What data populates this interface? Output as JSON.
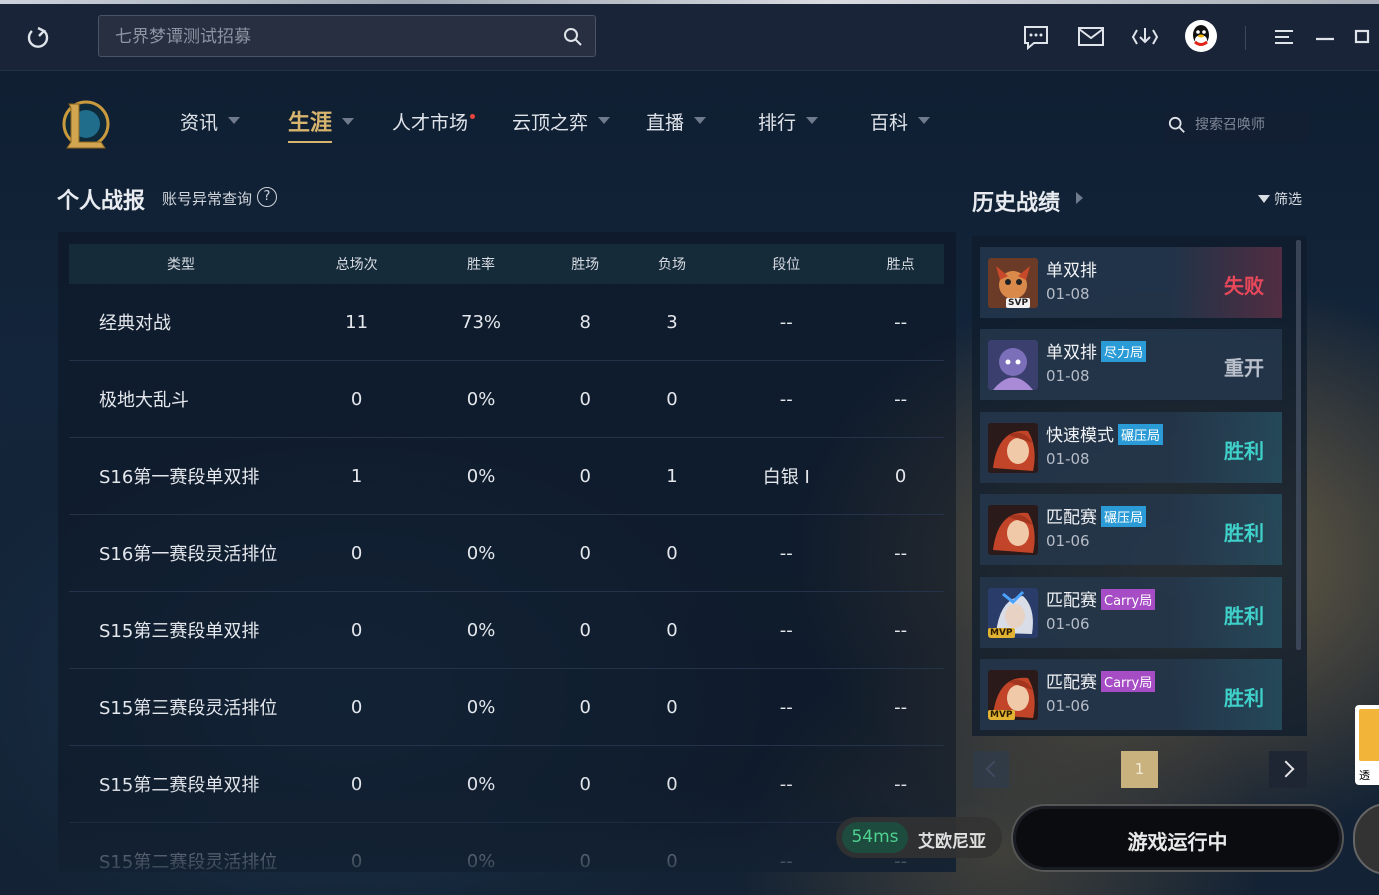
{
  "titlebar": {
    "search_placeholder": "七界梦谭测试招募",
    "icons": [
      "refresh-icon",
      "chat-icon",
      "mail-icon",
      "download-icon",
      "qq-avatar",
      "menu-icon",
      "minimize-icon",
      "restore-icon"
    ]
  },
  "nav": {
    "items": [
      {
        "label": "资讯",
        "caret": true
      },
      {
        "label": "生涯",
        "caret": true,
        "active": true
      },
      {
        "label": "人才市场",
        "dot": true
      },
      {
        "label": "云顶之弈",
        "caret": true
      },
      {
        "label": "直播",
        "caret": true
      },
      {
        "label": "排行",
        "caret": true
      },
      {
        "label": "百科",
        "caret": true
      }
    ],
    "summoner_search_placeholder": "搜索召唤师"
  },
  "stats": {
    "title": "个人战报",
    "sub_link": "账号异常查询",
    "help": "?",
    "columns": [
      "类型",
      "总场次",
      "胜率",
      "胜场",
      "负场",
      "段位",
      "胜点"
    ],
    "rows": [
      [
        "经典对战",
        "11",
        "73%",
        "8",
        "3",
        "--",
        "--"
      ],
      [
        "极地大乱斗",
        "0",
        "0%",
        "0",
        "0",
        "--",
        "--"
      ],
      [
        "S16第一赛段单双排",
        "1",
        "0%",
        "0",
        "1",
        "白银 Ⅰ",
        "0"
      ],
      [
        "S16第一赛段灵活排位",
        "0",
        "0%",
        "0",
        "0",
        "--",
        "--"
      ],
      [
        "S15第三赛段单双排",
        "0",
        "0%",
        "0",
        "0",
        "--",
        "--"
      ],
      [
        "S15第三赛段灵活排位",
        "0",
        "0%",
        "0",
        "0",
        "--",
        "--"
      ],
      [
        "S15第二赛段单双排",
        "0",
        "0%",
        "0",
        "0",
        "--",
        "--"
      ],
      [
        "S15第二赛段灵活排位",
        "0",
        "0%",
        "0",
        "0",
        "--",
        "--"
      ]
    ]
  },
  "history": {
    "title": "历史战绩",
    "filter": "筛选",
    "matches": [
      {
        "mode": "单双排",
        "tag": "",
        "tag_color": "",
        "date": "01-08",
        "result": "失败",
        "result_color": "#e8485a",
        "badge": "SVP",
        "champ": "yordle"
      },
      {
        "mode": "单双排",
        "tag": "尽力局",
        "tag_color": "#2a9bd6",
        "date": "01-08",
        "result": "重开",
        "result_color": "#b9c0cb",
        "badge": "",
        "champ": "purple"
      },
      {
        "mode": "快速模式",
        "tag": "碾压局",
        "tag_color": "#2a9bd6",
        "date": "01-08",
        "result": "胜利",
        "result_color": "#3fd0c9",
        "badge": "",
        "champ": "redhair"
      },
      {
        "mode": "匹配赛",
        "tag": "碾压局",
        "tag_color": "#2a9bd6",
        "date": "01-06",
        "result": "胜利",
        "result_color": "#3fd0c9",
        "badge": "",
        "champ": "redhair"
      },
      {
        "mode": "匹配赛",
        "tag": "Carry局",
        "tag_color": "#a64cc4",
        "date": "01-06",
        "result": "胜利",
        "result_color": "#3fd0c9",
        "badge": "MVP",
        "champ": "silver"
      },
      {
        "mode": "匹配赛",
        "tag": "Carry局",
        "tag_color": "#a64cc4",
        "date": "01-06",
        "result": "胜利",
        "result_color": "#3fd0c9",
        "badge": "MVP",
        "champ": "redhair"
      }
    ],
    "page": "1"
  },
  "footer": {
    "ping": "54ms",
    "server": "艾欧尼亚",
    "play_label": "游戏运行中"
  },
  "side_ad": {
    "text": "透"
  }
}
